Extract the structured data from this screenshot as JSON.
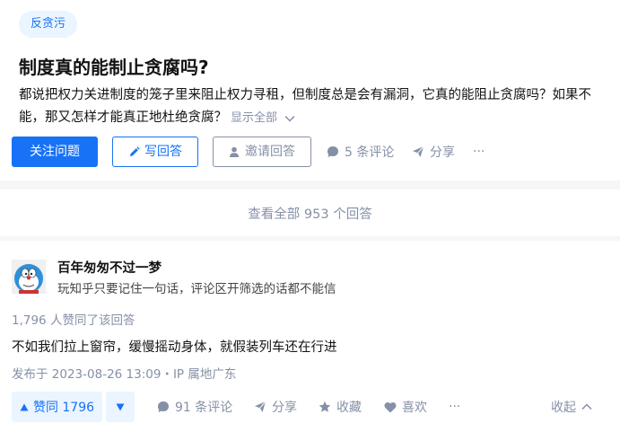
{
  "question": {
    "topic": "反贪污",
    "title": "制度真的能制止贪腐吗?",
    "description": "都说把权力关进制度的笼子里来阻止权力寻租，但制度总是会有漏洞，它真的能阻止贪腐吗？如果不能，那又怎样才能真正地杜绝贪腐？",
    "show_all": "显示全部",
    "follow_label": "关注问题",
    "write_label": "写回答",
    "invite_label": "邀请回答",
    "comments_label": "5 条评论",
    "share_label": "分享",
    "more_label": "···"
  },
  "view_all_answers": "查看全部 953 个回答",
  "answer": {
    "author_name": "百年匆匆不过一梦",
    "author_bio": "玩知乎只要记住一句话，评论区开筛选的话都不能信",
    "vote_summary": "1,796 人赞同了该回答",
    "content": "不如我们拉上窗帘，缓慢摇动身体，就假装列车还在行进",
    "published": "发布于 2023-08-26 13:09・IP 属地广东",
    "upvote_label": "赞同 1796",
    "comments_label": "91 条评论",
    "share_label": "分享",
    "collect_label": "收藏",
    "like_label": "喜欢",
    "more_label": "···",
    "collapse_label": "收起"
  },
  "colors": {
    "brand": "#1772f6",
    "muted": "#8590a6",
    "tag_bg": "#ebf5ff"
  },
  "icons": [
    "pencil-icon",
    "invite-person-icon",
    "comment-icon",
    "share-icon",
    "more-icon",
    "triangle-up-icon",
    "triangle-down-icon",
    "star-icon",
    "heart-icon",
    "chevron-down-icon",
    "chevron-up-icon"
  ]
}
